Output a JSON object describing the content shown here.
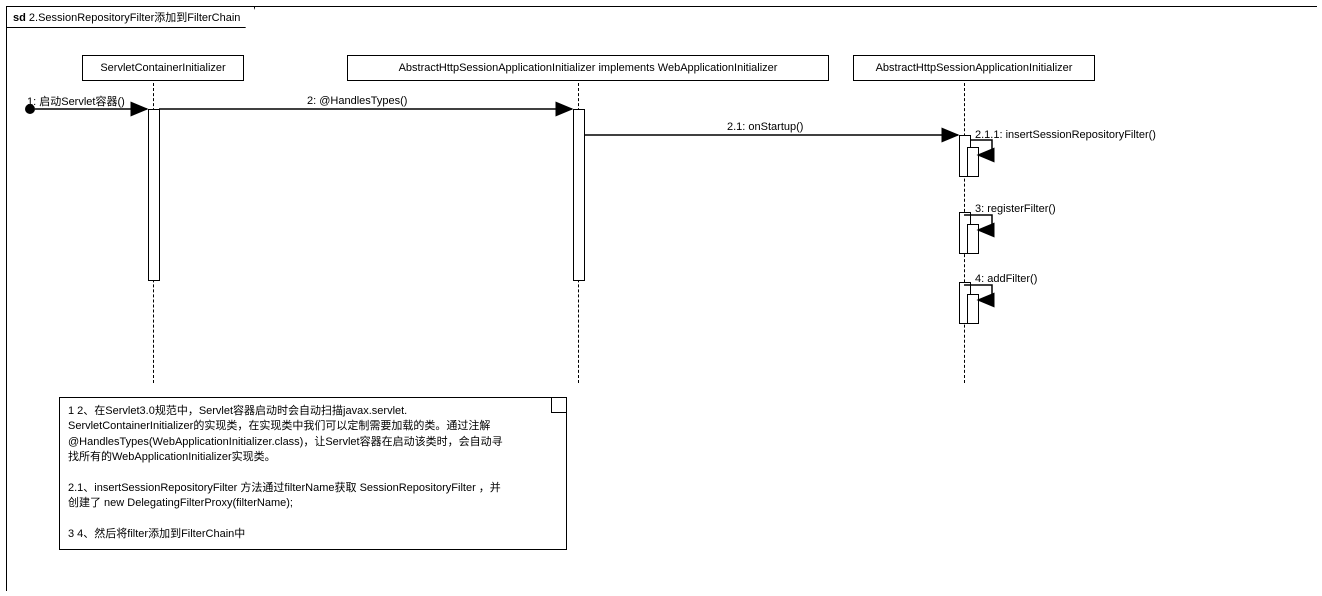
{
  "frame": {
    "prefix": "sd",
    "title": "2.SessionRepositoryFilter添加到FilterChain"
  },
  "lifelines": {
    "p1": "ServletContainerInitializer",
    "p2": "AbstractHttpSessionApplicationInitializer implements WebApplicationInitializer",
    "p3": "AbstractHttpSessionApplicationInitializer"
  },
  "messages": {
    "m1": "1: 启动Servlet容器()",
    "m2": "2: @HandlesTypes()",
    "m21": "2.1: onStartup()",
    "m211": "2.1.1: insertSessionRepositoryFilter()",
    "m3": "3: registerFilter()",
    "m4": "4: addFilter()"
  },
  "note": {
    "l1": "1 2、在Servlet3.0规范中，Servlet容器启动时会自动扫描javax.servlet.",
    "l2": "ServletContainerInitializer的实现类，在实现类中我们可以定制需要加载的类。通过注解",
    "l3": "@HandlesTypes(WebApplicationInitializer.class)，让Servlet容器在启动该类时，会自动寻",
    "l4": "找所有的WebApplicationInitializer实现类。",
    "l5": "2.1、insertSessionRepositoryFilter 方法通过filterName获取 SessionRepositoryFilter ，并",
    "l6": "创建了 new DelegatingFilterProxy(filterName);",
    "l7": "3 4、然后将filter添加到FilterChain中"
  },
  "chart_data": {
    "type": "table",
    "diagram_kind": "UML sequence diagram",
    "frame_label": "sd 2.SessionRepositoryFilter添加到FilterChain",
    "participants": [
      "ServletContainerInitializer",
      "AbstractHttpSessionApplicationInitializer implements WebApplicationInitializer",
      "AbstractHttpSessionApplicationInitializer"
    ],
    "messages": [
      {
        "seq": "1",
        "from": "start",
        "to": "ServletContainerInitializer",
        "label": "启动Servlet容器()"
      },
      {
        "seq": "2",
        "from": "ServletContainerInitializer",
        "to": "AbstractHttpSessionApplicationInitializer implements WebApplicationInitializer",
        "label": "@HandlesTypes()"
      },
      {
        "seq": "2.1",
        "from": "AbstractHttpSessionApplicationInitializer implements WebApplicationInitializer",
        "to": "AbstractHttpSessionApplicationInitializer",
        "label": "onStartup()"
      },
      {
        "seq": "2.1.1",
        "from": "AbstractHttpSessionApplicationInitializer",
        "to": "AbstractHttpSessionApplicationInitializer",
        "label": "insertSessionRepositoryFilter()",
        "self": true
      },
      {
        "seq": "3",
        "from": "AbstractHttpSessionApplicationInitializer",
        "to": "AbstractHttpSessionApplicationInitializer",
        "label": "registerFilter()",
        "self": true
      },
      {
        "seq": "4",
        "from": "AbstractHttpSessionApplicationInitializer",
        "to": "AbstractHttpSessionApplicationInitializer",
        "label": "addFilter()",
        "self": true
      }
    ],
    "note_text": "1 2、在Servlet3.0规范中，Servlet容器启动时会自动扫描javax.servlet.ServletContainerInitializer的实现类，在实现类中我们可以定制需要加载的类。通过注解@HandlesTypes(WebApplicationInitializer.class)，让Servlet容器在启动该类时，会自动寻找所有的WebApplicationInitializer实现类。\n2.1、insertSessionRepositoryFilter 方法通过filterName获取 SessionRepositoryFilter ，并创建了 new DelegatingFilterProxy(filterName);\n3 4、然后将filter添加到FilterChain中"
  }
}
